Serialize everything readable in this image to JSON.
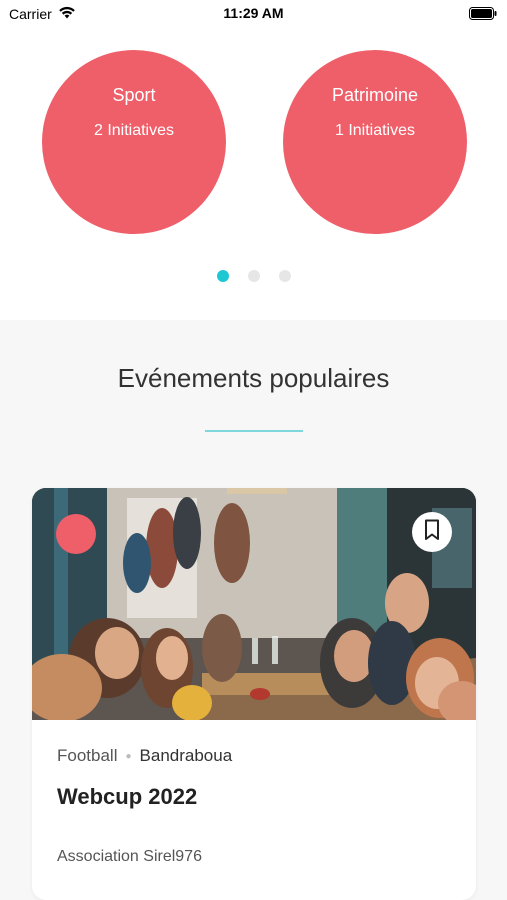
{
  "status_bar": {
    "carrier": "Carrier",
    "time": "11:29 AM",
    "icons": [
      "wifi-icon",
      "battery-icon"
    ]
  },
  "categories": {
    "items": [
      {
        "name": "Sport",
        "count": "2 Initiatives"
      },
      {
        "name": "Patrimoine",
        "count": "1 Initiatives"
      }
    ],
    "pagination": {
      "total": 3,
      "active": 1
    },
    "circle_color": "#ef5f6a",
    "active_dot_color": "#1ec8d2"
  },
  "popular": {
    "title": "Evénements populaires",
    "divider_color": "#7fd6dc",
    "event": {
      "category": "Football",
      "location": "Bandraboua",
      "title": "Webcup 2022",
      "organizer": "Association Sirel976",
      "badge_color": "#ef5f6a",
      "icons": [
        "bookmark-icon"
      ]
    }
  }
}
